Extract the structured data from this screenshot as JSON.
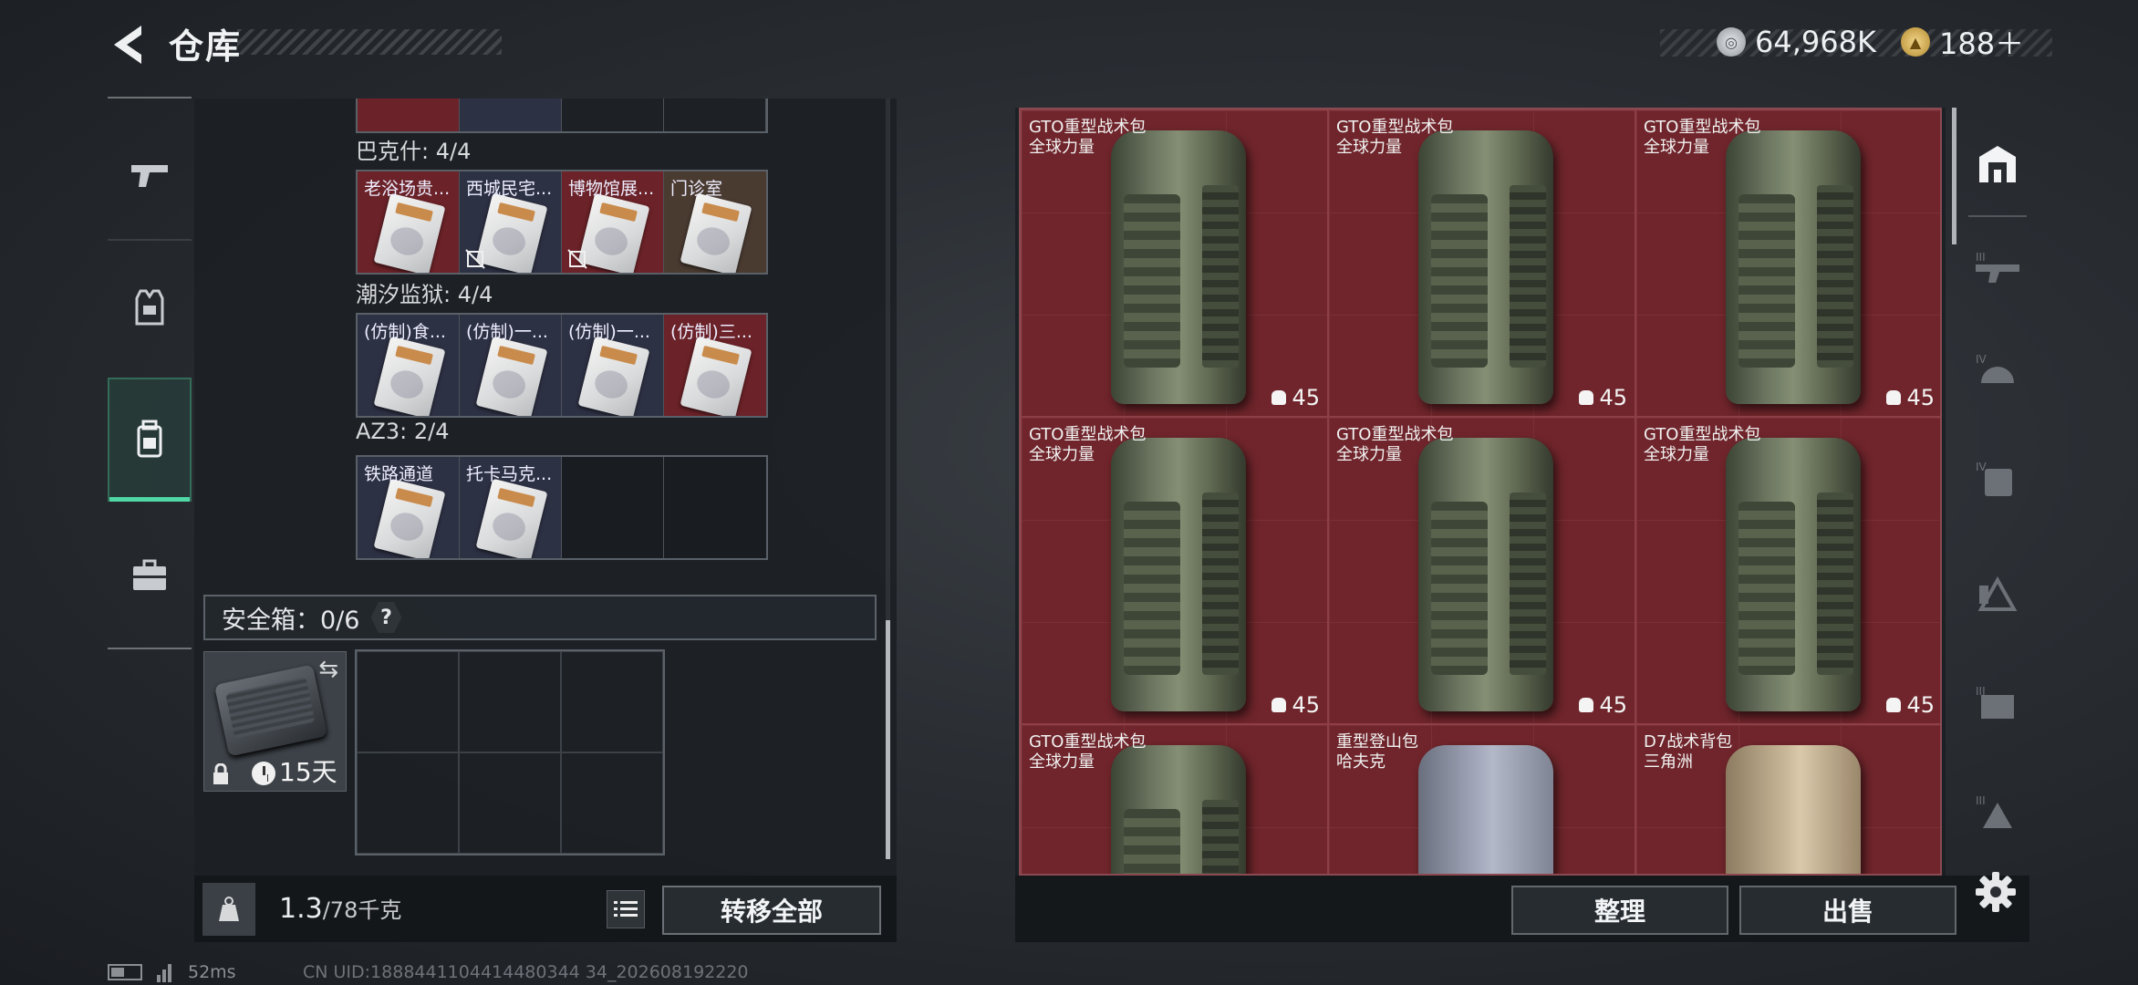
{
  "header": {
    "title": "仓库",
    "silver_amount": "64,968K",
    "gold_amount": "188＋"
  },
  "locker": {
    "sections": [
      {
        "title": "巴克什: 4/4",
        "items": [
          {
            "name": "老浴场贵...",
            "bg": "red",
            "nolink": false
          },
          {
            "name": "西城民宅...",
            "bg": "navy",
            "nolink": true
          },
          {
            "name": "博物馆展...",
            "bg": "red",
            "nolink": true
          },
          {
            "name": "门诊室",
            "bg": "brown",
            "nolink": false
          }
        ]
      },
      {
        "title": "潮汐监狱: 4/4",
        "items": [
          {
            "name": "(仿制)食...",
            "bg": "navy",
            "nolink": false
          },
          {
            "name": "(仿制)一...",
            "bg": "navy",
            "nolink": false
          },
          {
            "name": "(仿制)一...",
            "bg": "navy",
            "nolink": false
          },
          {
            "name": "(仿制)三...",
            "bg": "red",
            "nolink": false
          }
        ]
      },
      {
        "title": "AZ3: 2/4",
        "items": [
          {
            "name": "铁路通道",
            "bg": "navy",
            "nolink": false
          },
          {
            "name": "托卡马克...",
            "bg": "navy",
            "nolink": false
          },
          {
            "name": "",
            "bg": "empty",
            "nolink": false
          },
          {
            "name": "",
            "bg": "empty",
            "nolink": false
          }
        ]
      }
    ]
  },
  "safe": {
    "label": "安全箱：0/6",
    "help": "?",
    "case_days": "15天"
  },
  "footer_left": {
    "weight": "1.3",
    "weight_max": "/78千克",
    "transfer_all": "转移全部"
  },
  "stash": {
    "items": [
      {
        "name": "GTO重型战术包",
        "brand": "全球力量",
        "capacity": "45",
        "style": "green"
      },
      {
        "name": "GTO重型战术包",
        "brand": "全球力量",
        "capacity": "45",
        "style": "green"
      },
      {
        "name": "GTO重型战术包",
        "brand": "全球力量",
        "capacity": "45",
        "style": "green"
      },
      {
        "name": "GTO重型战术包",
        "brand": "全球力量",
        "capacity": "45",
        "style": "green"
      },
      {
        "name": "GTO重型战术包",
        "brand": "全球力量",
        "capacity": "45",
        "style": "green"
      },
      {
        "name": "GTO重型战术包",
        "brand": "全球力量",
        "capacity": "45",
        "style": "green"
      },
      {
        "name": "GTO重型战术包",
        "brand": "全球力量",
        "capacity": "",
        "style": "green"
      },
      {
        "name": "重型登山包",
        "brand": "哈夫克",
        "capacity": "",
        "style": "blue"
      },
      {
        "name": "D7战术背包",
        "brand": "三角洲",
        "capacity": "",
        "style": "tan"
      }
    ]
  },
  "footer_right": {
    "organize": "整理",
    "sell": "出售"
  },
  "status": {
    "ping": "52ms",
    "uid": "CN UID:1888441104414480344 34_202608192220"
  },
  "colors": {
    "accent": "#4fd7a6",
    "slot_red": "#6b2228",
    "stash_red": "#6f252b"
  }
}
